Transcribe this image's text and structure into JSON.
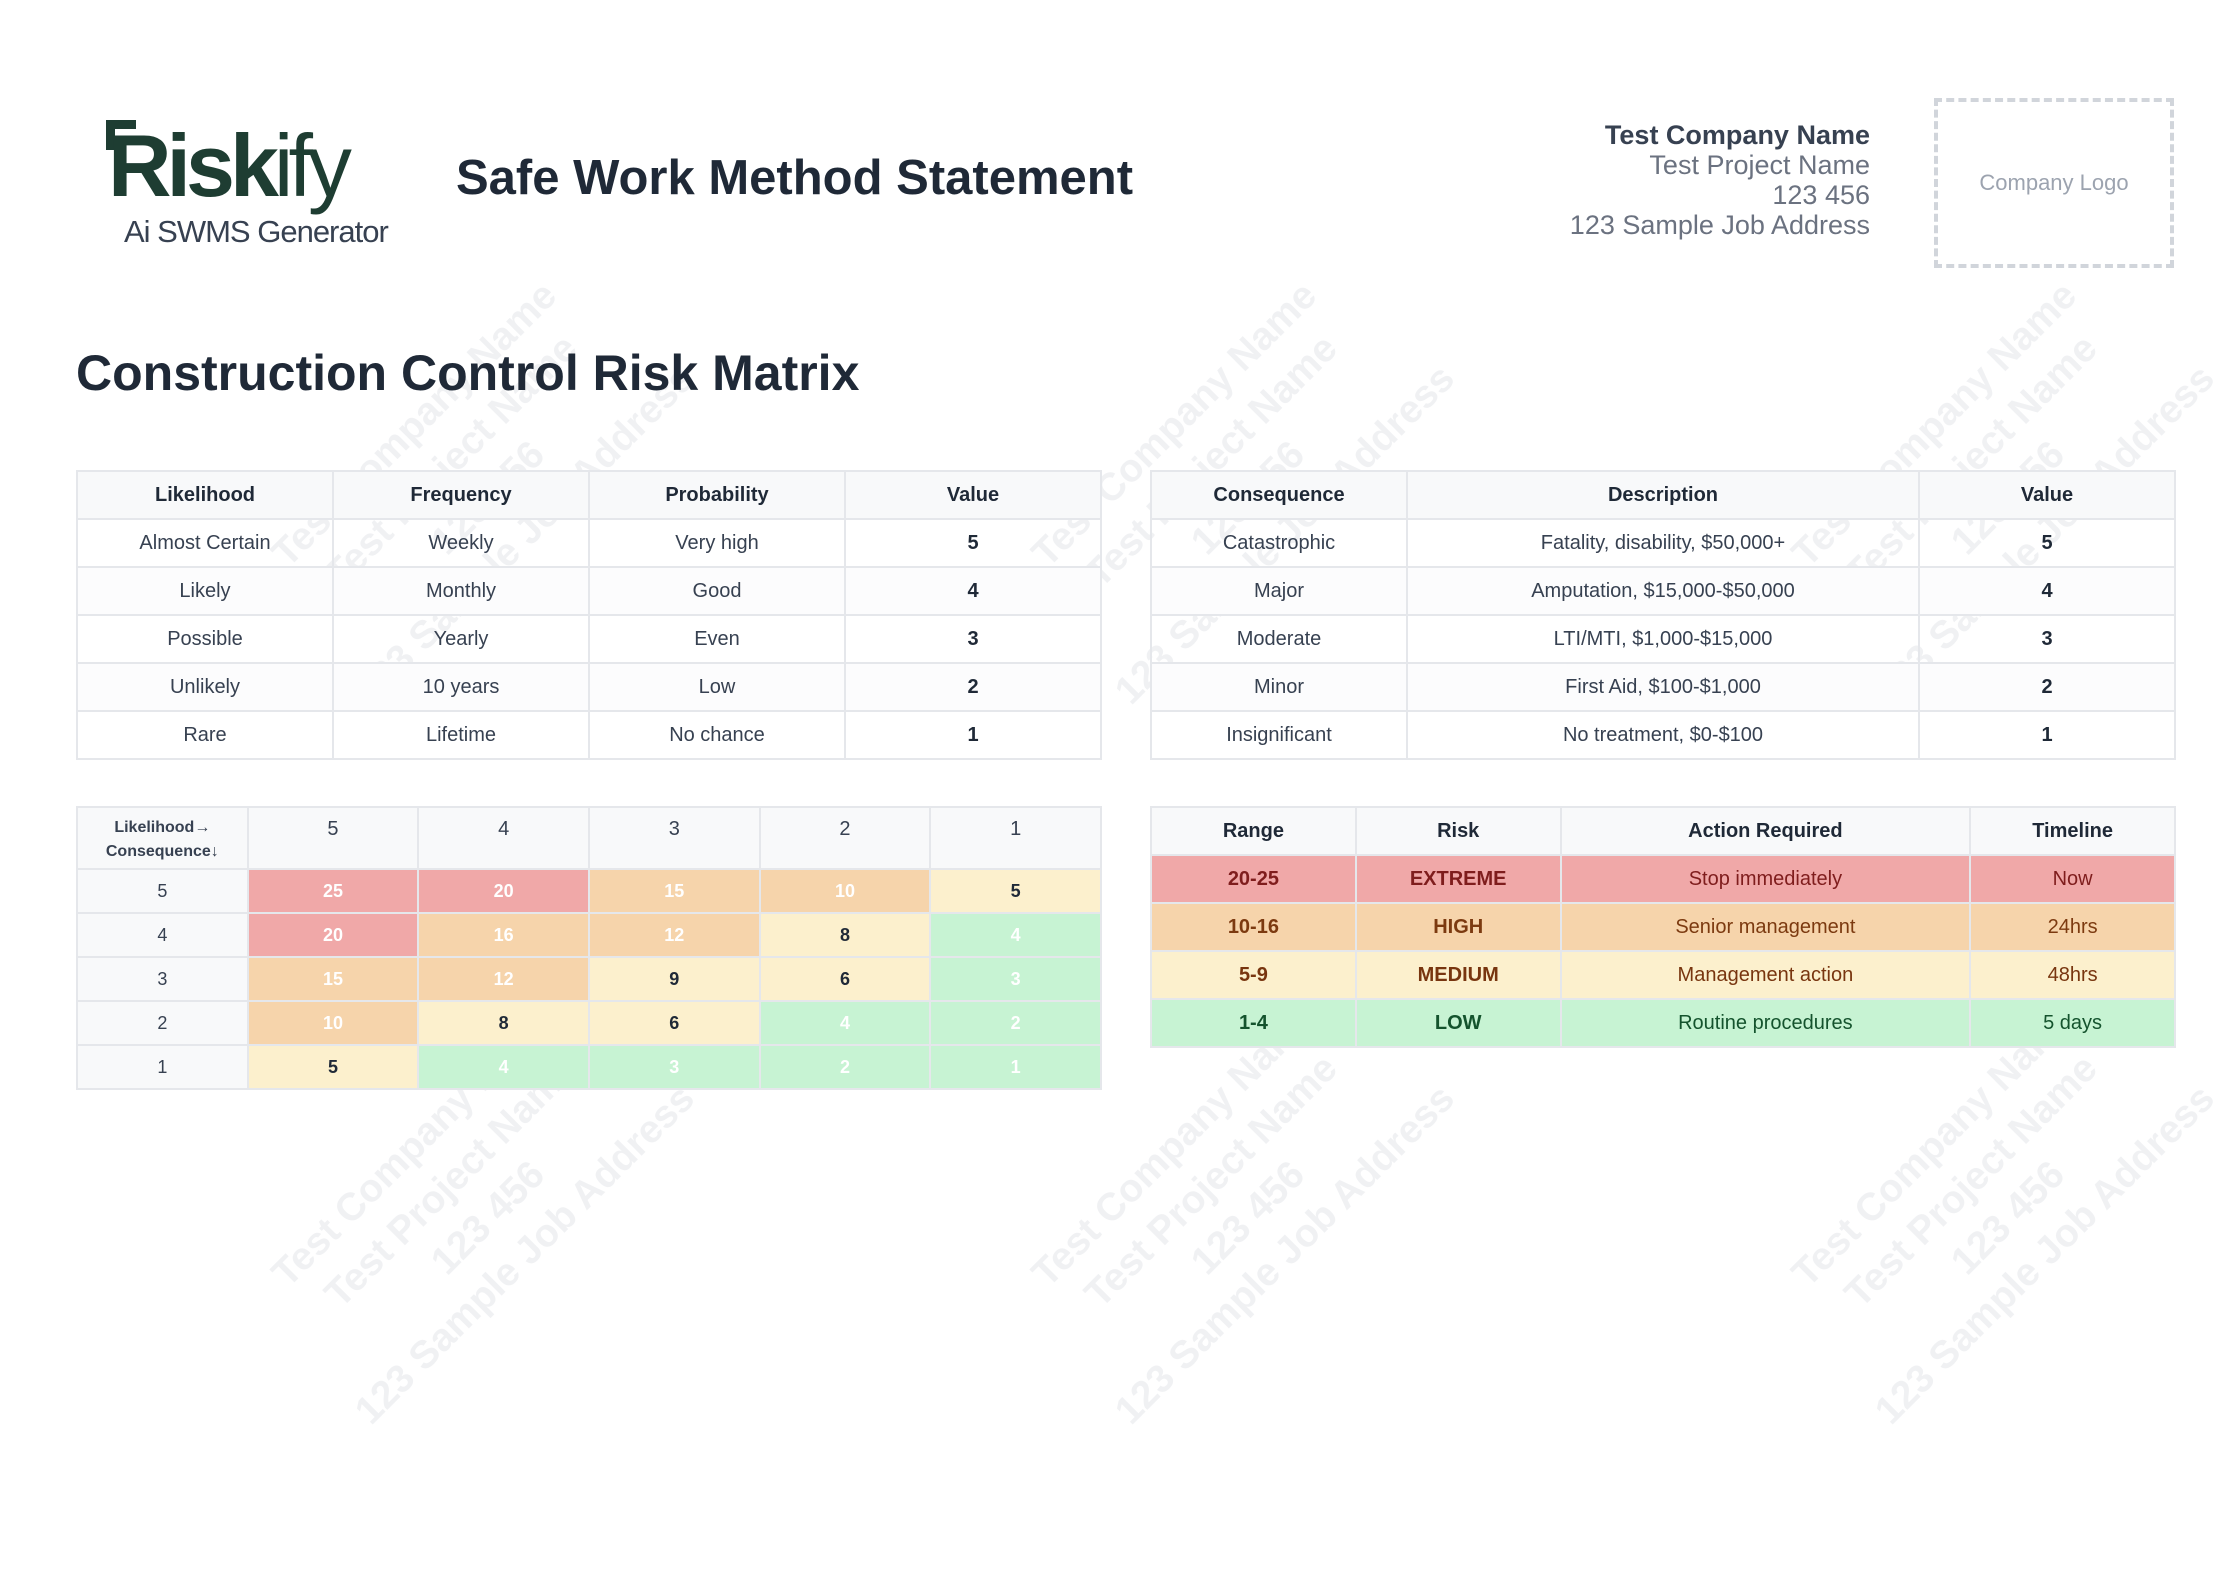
{
  "brand": {
    "logo_word": "Risk",
    "logo_word_suffix": "ify",
    "tagline": "Ai SWMS Generator"
  },
  "document_title": "Safe Work Method Statement",
  "company": {
    "name": "Test Company Name",
    "project": "Test Project Name",
    "number": "123 456",
    "address": "123 Sample Job Address",
    "logo_placeholder": "Company Logo"
  },
  "watermark_lines": [
    "Test Company Name",
    "Test Project Name",
    "123 456",
    "123 Sample Job Address"
  ],
  "section_title": "Construction Control Risk Matrix",
  "likelihood_table": {
    "headers": [
      "Likelihood",
      "Frequency",
      "Probability",
      "Value"
    ],
    "rows": [
      [
        "Almost Certain",
        "Weekly",
        "Very high",
        "5"
      ],
      [
        "Likely",
        "Monthly",
        "Good",
        "4"
      ],
      [
        "Possible",
        "Yearly",
        "Even",
        "3"
      ],
      [
        "Unlikely",
        "10 years",
        "Low",
        "2"
      ],
      [
        "Rare",
        "Lifetime",
        "No chance",
        "1"
      ]
    ]
  },
  "consequence_table": {
    "headers": [
      "Consequence",
      "Description",
      "Value"
    ],
    "rows": [
      [
        "Catastrophic",
        "Fatality, disability, $50,000+",
        "5"
      ],
      [
        "Major",
        "Amputation, $15,000-$50,000",
        "4"
      ],
      [
        "Moderate",
        "LTI/MTI, $1,000-$15,000",
        "3"
      ],
      [
        "Minor",
        "First Aid, $100-$1,000",
        "2"
      ],
      [
        "Insignificant",
        "No treatment, $0-$100",
        "1"
      ]
    ]
  },
  "matrix": {
    "corner_top": "Likelihood→",
    "corner_bottom": "Consequence↓",
    "column_headers": [
      "5",
      "4",
      "3",
      "2",
      "1"
    ],
    "rows": [
      {
        "label": "5",
        "cells": [
          {
            "v": "25",
            "level": "ext"
          },
          {
            "v": "20",
            "level": "ext"
          },
          {
            "v": "15",
            "level": "high"
          },
          {
            "v": "10",
            "level": "high"
          },
          {
            "v": "5",
            "level": "med"
          }
        ]
      },
      {
        "label": "4",
        "cells": [
          {
            "v": "20",
            "level": "ext"
          },
          {
            "v": "16",
            "level": "high"
          },
          {
            "v": "12",
            "level": "high"
          },
          {
            "v": "8",
            "level": "med"
          },
          {
            "v": "4",
            "level": "low"
          }
        ]
      },
      {
        "label": "3",
        "cells": [
          {
            "v": "15",
            "level": "high"
          },
          {
            "v": "12",
            "level": "high"
          },
          {
            "v": "9",
            "level": "med"
          },
          {
            "v": "6",
            "level": "med"
          },
          {
            "v": "3",
            "level": "low"
          }
        ]
      },
      {
        "label": "2",
        "cells": [
          {
            "v": "10",
            "level": "high"
          },
          {
            "v": "8",
            "level": "med"
          },
          {
            "v": "6",
            "level": "med"
          },
          {
            "v": "4",
            "level": "low"
          },
          {
            "v": "2",
            "level": "low"
          }
        ]
      },
      {
        "label": "1",
        "cells": [
          {
            "v": "5",
            "level": "med"
          },
          {
            "v": "4",
            "level": "low"
          },
          {
            "v": "3",
            "level": "low"
          },
          {
            "v": "2",
            "level": "low"
          },
          {
            "v": "1",
            "level": "low"
          }
        ]
      }
    ]
  },
  "risk_levels": {
    "headers": [
      "Range",
      "Risk",
      "Action Required",
      "Timeline"
    ],
    "rows": [
      {
        "range": "20-25",
        "risk": "EXTREME",
        "action": "Stop immediately",
        "timeline": "Now",
        "level": "ext"
      },
      {
        "range": "10-16",
        "risk": "HIGH",
        "action": "Senior management",
        "timeline": "24hrs",
        "level": "high"
      },
      {
        "range": "5-9",
        "risk": "MEDIUM",
        "action": "Management action",
        "timeline": "48hrs",
        "level": "med"
      },
      {
        "range": "1-4",
        "risk": "LOW",
        "action": "Routine procedures",
        "timeline": "5 days",
        "level": "low"
      }
    ]
  },
  "colors": {
    "extreme": "#f0a8a8",
    "high": "#f6d4ab",
    "medium": "#fcf0cd",
    "low": "#c7f3d3",
    "brand": "#1e3d32"
  }
}
